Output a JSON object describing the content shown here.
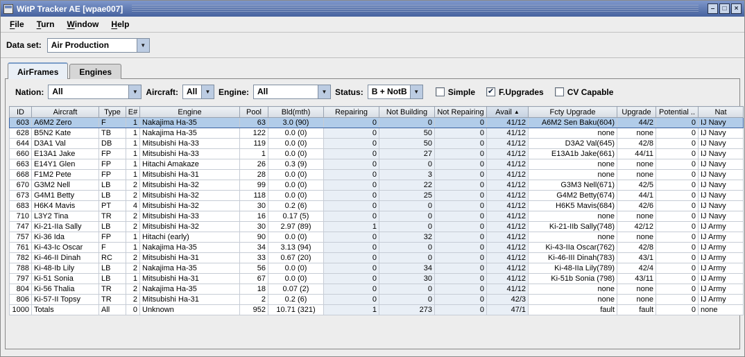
{
  "window": {
    "title": "WitP Tracker AE [wpae007]",
    "controls": {
      "minimize": "–",
      "maximize": "□",
      "close": "×"
    },
    "menus": [
      {
        "label": "File"
      },
      {
        "label": "Turn"
      },
      {
        "label": "Window"
      },
      {
        "label": "Help"
      }
    ]
  },
  "icons": {
    "combo_arrow": "▼",
    "check": "✔"
  },
  "dataset": {
    "label": "Data set:",
    "value": "Air Production"
  },
  "tabs": [
    {
      "label": "AirFrames",
      "selected": true
    },
    {
      "label": "Engines",
      "selected": false
    }
  ],
  "filters": {
    "nation": {
      "label": "Nation:",
      "value": "All"
    },
    "aircraft": {
      "label": "Aircraft:",
      "value": "All"
    },
    "engine": {
      "label": "Engine:",
      "value": "All"
    },
    "status": {
      "label": "Status:",
      "value": "B + NotB"
    },
    "checkboxes": [
      {
        "label": "Simple",
        "checked": false
      },
      {
        "label": "F.Upgrades",
        "checked": true
      },
      {
        "label": "CV Capable",
        "checked": false
      }
    ]
  },
  "table": {
    "columns": [
      "ID",
      "Aircraft",
      "Type",
      "E#",
      "Engine",
      "Pool",
      "Bld(mth)",
      "Repairing",
      "Not Building",
      "Not Repairing",
      "Avail",
      "Fcty Upgrade",
      "Upgrade",
      "Potential ..",
      "Nat"
    ],
    "sort": {
      "column": "Avail",
      "direction": "ascending",
      "icon": "▲"
    },
    "selected_id": "603",
    "rows": [
      [
        "603",
        "A6M2 Zero",
        "F",
        "1",
        "Nakajima Ha-35",
        "63",
        "3.0 (90)",
        "0",
        "0",
        "0",
        "41/12",
        "A6M2 Sen Baku(604)",
        "44/2",
        "0",
        "IJ Navy"
      ],
      [
        "628",
        "B5N2 Kate",
        "TB",
        "1",
        "Nakajima Ha-35",
        "122",
        "0.0 (0)",
        "0",
        "50",
        "0",
        "41/12",
        "none",
        "none",
        "0",
        "IJ Navy"
      ],
      [
        "644",
        "D3A1 Val",
        "DB",
        "1",
        "Mitsubishi Ha-33",
        "119",
        "0.0 (0)",
        "0",
        "50",
        "0",
        "41/12",
        "D3A2 Val(645)",
        "42/8",
        "0",
        "IJ Navy"
      ],
      [
        "660",
        "E13A1 Jake",
        "FP",
        "1",
        "Mitsubishi Ha-33",
        "1",
        "0.0 (0)",
        "0",
        "27",
        "0",
        "41/12",
        "E13A1b Jake(661)",
        "44/11",
        "0",
        "IJ Navy"
      ],
      [
        "663",
        "E14Y1 Glen",
        "FP",
        "1",
        "Hitachi Amakaze",
        "26",
        "0.3 (9)",
        "0",
        "0",
        "0",
        "41/12",
        "none",
        "none",
        "0",
        "IJ Navy"
      ],
      [
        "668",
        "F1M2 Pete",
        "FP",
        "1",
        "Mitsubishi Ha-31",
        "28",
        "0.0 (0)",
        "0",
        "3",
        "0",
        "41/12",
        "none",
        "none",
        "0",
        "IJ Navy"
      ],
      [
        "670",
        "G3M2 Nell",
        "LB",
        "2",
        "Mitsubishi Ha-32",
        "99",
        "0.0 (0)",
        "0",
        "22",
        "0",
        "41/12",
        "G3M3 Nell(671)",
        "42/5",
        "0",
        "IJ Navy"
      ],
      [
        "673",
        "G4M1 Betty",
        "LB",
        "2",
        "Mitsubishi Ha-32",
        "118",
        "0.0 (0)",
        "0",
        "25",
        "0",
        "41/12",
        "G4M2 Betty(674)",
        "44/1",
        "0",
        "IJ Navy"
      ],
      [
        "683",
        "H6K4 Mavis",
        "PT",
        "4",
        "Mitsubishi Ha-32",
        "30",
        "0.2 (6)",
        "0",
        "0",
        "0",
        "41/12",
        "H6K5 Mavis(684)",
        "42/6",
        "0",
        "IJ Navy"
      ],
      [
        "710",
        "L3Y2 Tina",
        "TR",
        "2",
        "Mitsubishi Ha-33",
        "16",
        "0.17 (5)",
        "0",
        "0",
        "0",
        "41/12",
        "none",
        "none",
        "0",
        "IJ Navy"
      ],
      [
        "747",
        "Ki-21-IIa Sally",
        "LB",
        "2",
        "Mitsubishi Ha-32",
        "30",
        "2.97 (89)",
        "1",
        "0",
        "0",
        "41/12",
        "Ki-21-IIb Sally(748)",
        "42/12",
        "0",
        "IJ Army"
      ],
      [
        "757",
        "Ki-36 Ida",
        "FP",
        "1",
        "Hitachi (early)",
        "90",
        "0.0 (0)",
        "0",
        "32",
        "0",
        "41/12",
        "none",
        "none",
        "0",
        "IJ Army"
      ],
      [
        "761",
        "Ki-43-Ic Oscar",
        "F",
        "1",
        "Nakajima Ha-35",
        "34",
        "3.13 (94)",
        "0",
        "0",
        "0",
        "41/12",
        "Ki-43-IIa Oscar(762)",
        "42/8",
        "0",
        "IJ Army"
      ],
      [
        "782",
        "Ki-46-II Dinah",
        "RC",
        "2",
        "Mitsubishi Ha-31",
        "33",
        "0.67 (20)",
        "0",
        "0",
        "0",
        "41/12",
        "Ki-46-III Dinah(783)",
        "43/1",
        "0",
        "IJ Army"
      ],
      [
        "788",
        "Ki-48-Ib Lily",
        "LB",
        "2",
        "Nakajima Ha-35",
        "56",
        "0.0 (0)",
        "0",
        "34",
        "0",
        "41/12",
        "Ki-48-IIa Lily(789)",
        "42/4",
        "0",
        "IJ Army"
      ],
      [
        "797",
        "Ki-51 Sonia",
        "LB",
        "1",
        "Mitsubishi Ha-31",
        "67",
        "0.0 (0)",
        "0",
        "30",
        "0",
        "41/12",
        "Ki-51b Sonia (798)",
        "43/11",
        "0",
        "IJ Army"
      ],
      [
        "804",
        "Ki-56 Thalia",
        "TR",
        "2",
        "Nakajima Ha-35",
        "18",
        "0.07 (2)",
        "0",
        "0",
        "0",
        "41/12",
        "none",
        "none",
        "0",
        "IJ Army"
      ],
      [
        "806",
        "Ki-57-II Topsy",
        "TR",
        "2",
        "Mitsubishi Ha-31",
        "2",
        "0.2 (6)",
        "0",
        "0",
        "0",
        "42/3",
        "none",
        "none",
        "0",
        "IJ Army"
      ],
      [
        "1000",
        "Totals",
        "All",
        "0",
        "Unknown",
        "952",
        "10.71 (321)",
        "1",
        "273",
        "0",
        "47/1",
        "fault",
        "fault",
        "0",
        "none"
      ]
    ]
  },
  "colors": {
    "titlebar_top": "#7E97CB",
    "titlebar_bottom": "#46629E",
    "selection": "#B1CCE9",
    "selection_border": "#3A62A0",
    "column_tint": "#E9EFF6",
    "panel_bg": "#EDEDED"
  }
}
